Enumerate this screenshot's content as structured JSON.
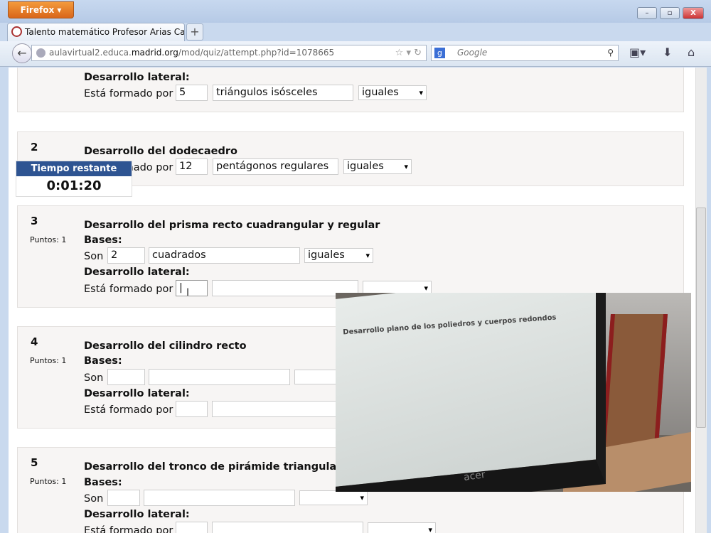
{
  "browser": {
    "menu_label": "Firefox",
    "tab_title": "Talento matemático Profesor Arias Cabe...",
    "new_tab": "+",
    "url_prefix": "aulavirtual2.educa.",
    "url_domain": "madrid.org",
    "url_path": "/mod/quiz/attempt.php?id=1078665",
    "search_placeholder": "Google",
    "search_engine": "g",
    "win_min": "–",
    "win_max": "▫",
    "win_close": "X"
  },
  "timer": {
    "label": "Tiempo restante",
    "value": "0:01:20"
  },
  "questions": [
    {
      "lateral_label": "Desarrollo lateral:",
      "lateral_prefix": "Está formado por",
      "lateral_number": "5",
      "lateral_shape": "triángulos isósceles",
      "lateral_select": "iguales"
    },
    {
      "number": "2",
      "title": "Desarrollo del dodecaedro",
      "lateral_prefix": "Está formado por",
      "lateral_number": "12",
      "lateral_shape": "pentágonos regulares",
      "lateral_select": "iguales"
    },
    {
      "number": "3",
      "points": "Puntos: 1",
      "title": "Desarrollo del prisma recto cuadrangular y regular",
      "bases_label": "Bases:",
      "bases_prefix": "Son",
      "bases_number": "2",
      "bases_shape": "cuadrados",
      "bases_select": "iguales",
      "lateral_label": "Desarrollo lateral:",
      "lateral_prefix": "Está formado por",
      "lateral_number": "|"
    },
    {
      "number": "4",
      "points": "Puntos: 1",
      "title": "Desarrollo del cilindro recto",
      "bases_label": "Bases:",
      "bases_prefix": "Son",
      "lateral_label": "Desarrollo lateral:",
      "lateral_prefix": "Está formado por"
    },
    {
      "number": "5",
      "points": "Puntos: 1",
      "title": "Desarrollo del tronco de pirámide triangular",
      "bases_label": "Bases:",
      "bases_prefix": "Son",
      "lateral_label": "Desarrollo lateral:",
      "lateral_prefix": "Está formado por"
    }
  ],
  "video": {
    "screen_heading": "Desarrollo plano de los poliedros y cuerpos redondos",
    "brand": "acer"
  }
}
